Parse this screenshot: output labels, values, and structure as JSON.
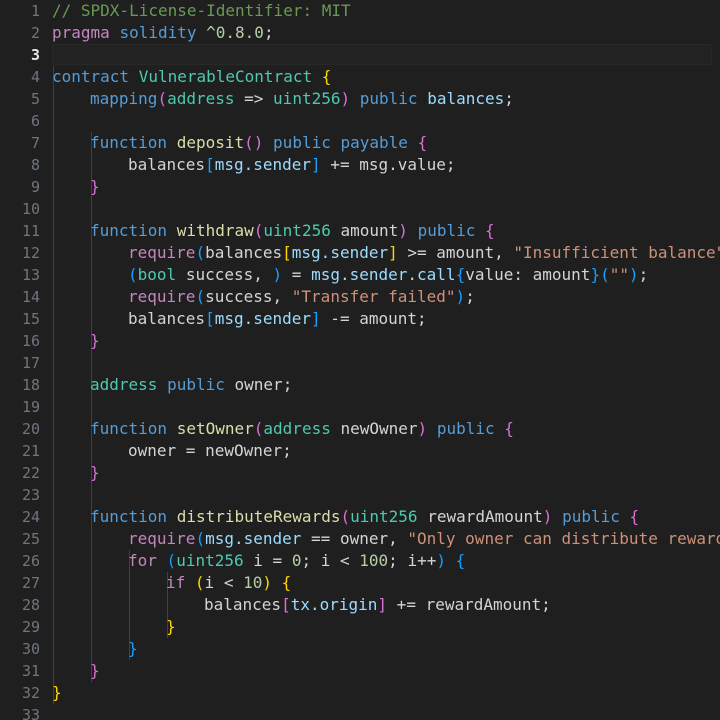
{
  "editor": {
    "language": "solidity",
    "theme": "dark-plus",
    "background": "#1f1f1f",
    "active_line": 3,
    "total_lines": 33,
    "line_numbers": [
      "1",
      "2",
      "3",
      "4",
      "5",
      "6",
      "7",
      "8",
      "9",
      "10",
      "11",
      "12",
      "13",
      "14",
      "15",
      "16",
      "17",
      "18",
      "19",
      "20",
      "21",
      "22",
      "23",
      "24",
      "25",
      "26",
      "27",
      "28",
      "29",
      "30",
      "31",
      "32",
      "33"
    ],
    "colors": {
      "comment": "#6a9955",
      "keyword": "#c586c0",
      "keyword_blue": "#569cd6",
      "type": "#4ec9b0",
      "function": "#dcdcaa",
      "string": "#ce9178",
      "number": "#b5cea8",
      "variable": "#9cdcfe",
      "plain": "#d4d4d4",
      "bracket_1": "#ffd700",
      "bracket_2": "#da70d6",
      "bracket_3": "#179fff",
      "line_number": "#6e7681",
      "line_number_active": "#e6e6e6",
      "indent_guide": "#404040"
    },
    "lines_plain": [
      "// SPDX-License-Identifier: MIT",
      "pragma solidity ^0.8.0;",
      "",
      "contract VulnerableContract {",
      "    mapping(address => uint256) public balances;",
      "",
      "    function deposit() public payable {",
      "        balances[msg.sender] += msg.value;",
      "    }",
      "",
      "    function withdraw(uint256 amount) public {",
      "        require(balances[msg.sender] >= amount, \"Insufficient balance\");",
      "        (bool success, ) = msg.sender.call{value: amount}(\"\");",
      "        require(success, \"Transfer failed\");",
      "        balances[msg.sender] -= amount;",
      "    }",
      "",
      "    address public owner;",
      "",
      "    function setOwner(address newOwner) public {",
      "        owner = newOwner;",
      "    }",
      "",
      "    function distributeRewards(uint256 rewardAmount) public {",
      "        require(msg.sender == owner, \"Only owner can distribute rewards\");",
      "        for (uint256 i = 0; i < 100; i++) {",
      "            if (i < 10) {",
      "                balances[tx.origin] += rewardAmount;",
      "            }",
      "        }",
      "    }",
      "}",
      ""
    ],
    "lines": [
      {
        "n": 1,
        "indent": 0,
        "tokens": [
          {
            "t": "// SPDX-License-Identifier: MIT",
            "c": "cmt"
          }
        ]
      },
      {
        "n": 2,
        "indent": 0,
        "tokens": [
          {
            "t": "pragma",
            "c": "kw"
          },
          {
            "t": " ",
            "c": "pln"
          },
          {
            "t": "solidity",
            "c": "kw2"
          },
          {
            "t": " ",
            "c": "pln"
          },
          {
            "t": "^0.8.0",
            "c": "num"
          },
          {
            "t": ";",
            "c": "pln"
          }
        ]
      },
      {
        "n": 3,
        "indent": 0,
        "tokens": []
      },
      {
        "n": 4,
        "indent": 0,
        "tokens": [
          {
            "t": "contract",
            "c": "kw2"
          },
          {
            "t": " ",
            "c": "pln"
          },
          {
            "t": "VulnerableContract",
            "c": "typ"
          },
          {
            "t": " ",
            "c": "pln"
          },
          {
            "t": "{",
            "c": "b1"
          }
        ]
      },
      {
        "n": 5,
        "indent": 1,
        "tokens": [
          {
            "t": "mapping",
            "c": "kw2"
          },
          {
            "t": "(",
            "c": "b2"
          },
          {
            "t": "address",
            "c": "typ"
          },
          {
            "t": " => ",
            "c": "pln"
          },
          {
            "t": "uint256",
            "c": "typ"
          },
          {
            "t": ")",
            "c": "b2"
          },
          {
            "t": " ",
            "c": "pln"
          },
          {
            "t": "public",
            "c": "kw2"
          },
          {
            "t": " ",
            "c": "pln"
          },
          {
            "t": "balances",
            "c": "var"
          },
          {
            "t": ";",
            "c": "pln"
          }
        ]
      },
      {
        "n": 6,
        "indent": 1,
        "tokens": []
      },
      {
        "n": 7,
        "indent": 1,
        "tokens": [
          {
            "t": "function",
            "c": "kw2"
          },
          {
            "t": " ",
            "c": "pln"
          },
          {
            "t": "deposit",
            "c": "fn"
          },
          {
            "t": "()",
            "c": "b2"
          },
          {
            "t": " ",
            "c": "pln"
          },
          {
            "t": "public",
            "c": "kw2"
          },
          {
            "t": " ",
            "c": "pln"
          },
          {
            "t": "payable",
            "c": "kw2"
          },
          {
            "t": " ",
            "c": "pln"
          },
          {
            "t": "{",
            "c": "b2"
          }
        ]
      },
      {
        "n": 8,
        "indent": 2,
        "tokens": [
          {
            "t": "balances",
            "c": "pln"
          },
          {
            "t": "[",
            "c": "b3"
          },
          {
            "t": "msg.sender",
            "c": "var"
          },
          {
            "t": "]",
            "c": "b3"
          },
          {
            "t": " += ",
            "c": "pln"
          },
          {
            "t": "msg.value",
            "c": "pln"
          },
          {
            "t": ";",
            "c": "pln"
          }
        ]
      },
      {
        "n": 9,
        "indent": 1,
        "tokens": [
          {
            "t": "}",
            "c": "b2"
          }
        ]
      },
      {
        "n": 10,
        "indent": 1,
        "tokens": []
      },
      {
        "n": 11,
        "indent": 1,
        "tokens": [
          {
            "t": "function",
            "c": "kw2"
          },
          {
            "t": " ",
            "c": "pln"
          },
          {
            "t": "withdraw",
            "c": "fn"
          },
          {
            "t": "(",
            "c": "b2"
          },
          {
            "t": "uint256",
            "c": "typ"
          },
          {
            "t": " ",
            "c": "pln"
          },
          {
            "t": "amount",
            "c": "pln"
          },
          {
            "t": ")",
            "c": "b2"
          },
          {
            "t": " ",
            "c": "pln"
          },
          {
            "t": "public",
            "c": "kw2"
          },
          {
            "t": " ",
            "c": "pln"
          },
          {
            "t": "{",
            "c": "b2"
          }
        ]
      },
      {
        "n": 12,
        "indent": 2,
        "tokens": [
          {
            "t": "require",
            "c": "kw"
          },
          {
            "t": "(",
            "c": "b3"
          },
          {
            "t": "balances",
            "c": "pln"
          },
          {
            "t": "[",
            "c": "b1"
          },
          {
            "t": "msg.sender",
            "c": "var"
          },
          {
            "t": "]",
            "c": "b1"
          },
          {
            "t": " >= ",
            "c": "pln"
          },
          {
            "t": "amount",
            "c": "pln"
          },
          {
            "t": ", ",
            "c": "pln"
          },
          {
            "t": "\"Insufficient balance\"",
            "c": "str"
          },
          {
            "t": ")",
            "c": "b3"
          },
          {
            "t": ";",
            "c": "pln"
          }
        ]
      },
      {
        "n": 13,
        "indent": 2,
        "tokens": [
          {
            "t": "(",
            "c": "b3"
          },
          {
            "t": "bool",
            "c": "typ"
          },
          {
            "t": " ",
            "c": "pln"
          },
          {
            "t": "success",
            "c": "pln"
          },
          {
            "t": ", ",
            "c": "pln"
          },
          {
            "t": ")",
            "c": "b3"
          },
          {
            "t": " = ",
            "c": "pln"
          },
          {
            "t": "msg.sender",
            "c": "var"
          },
          {
            "t": ".",
            "c": "pln"
          },
          {
            "t": "call",
            "c": "var"
          },
          {
            "t": "{",
            "c": "b3"
          },
          {
            "t": "value",
            "c": "pln"
          },
          {
            "t": ": ",
            "c": "pln"
          },
          {
            "t": "amount",
            "c": "pln"
          },
          {
            "t": "}",
            "c": "b3"
          },
          {
            "t": "(",
            "c": "b3"
          },
          {
            "t": "\"\"",
            "c": "str"
          },
          {
            "t": ")",
            "c": "b3"
          },
          {
            "t": ";",
            "c": "pln"
          }
        ]
      },
      {
        "n": 14,
        "indent": 2,
        "tokens": [
          {
            "t": "require",
            "c": "kw"
          },
          {
            "t": "(",
            "c": "b3"
          },
          {
            "t": "success",
            "c": "pln"
          },
          {
            "t": ", ",
            "c": "pln"
          },
          {
            "t": "\"Transfer failed\"",
            "c": "str"
          },
          {
            "t": ")",
            "c": "b3"
          },
          {
            "t": ";",
            "c": "pln"
          }
        ]
      },
      {
        "n": 15,
        "indent": 2,
        "tokens": [
          {
            "t": "balances",
            "c": "pln"
          },
          {
            "t": "[",
            "c": "b3"
          },
          {
            "t": "msg.sender",
            "c": "var"
          },
          {
            "t": "]",
            "c": "b3"
          },
          {
            "t": " -= ",
            "c": "pln"
          },
          {
            "t": "amount",
            "c": "pln"
          },
          {
            "t": ";",
            "c": "pln"
          }
        ]
      },
      {
        "n": 16,
        "indent": 1,
        "tokens": [
          {
            "t": "}",
            "c": "b2"
          }
        ]
      },
      {
        "n": 17,
        "indent": 1,
        "tokens": []
      },
      {
        "n": 18,
        "indent": 1,
        "tokens": [
          {
            "t": "address",
            "c": "typ"
          },
          {
            "t": " ",
            "c": "pln"
          },
          {
            "t": "public",
            "c": "kw2"
          },
          {
            "t": " ",
            "c": "pln"
          },
          {
            "t": "owner",
            "c": "pln"
          },
          {
            "t": ";",
            "c": "pln"
          }
        ]
      },
      {
        "n": 19,
        "indent": 1,
        "tokens": []
      },
      {
        "n": 20,
        "indent": 1,
        "tokens": [
          {
            "t": "function",
            "c": "kw2"
          },
          {
            "t": " ",
            "c": "pln"
          },
          {
            "t": "setOwner",
            "c": "fn"
          },
          {
            "t": "(",
            "c": "b2"
          },
          {
            "t": "address",
            "c": "typ"
          },
          {
            "t": " ",
            "c": "pln"
          },
          {
            "t": "newOwner",
            "c": "pln"
          },
          {
            "t": ")",
            "c": "b2"
          },
          {
            "t": " ",
            "c": "pln"
          },
          {
            "t": "public",
            "c": "kw2"
          },
          {
            "t": " ",
            "c": "pln"
          },
          {
            "t": "{",
            "c": "b2"
          }
        ]
      },
      {
        "n": 21,
        "indent": 2,
        "tokens": [
          {
            "t": "owner",
            "c": "pln"
          },
          {
            "t": " = ",
            "c": "pln"
          },
          {
            "t": "newOwner",
            "c": "pln"
          },
          {
            "t": ";",
            "c": "pln"
          }
        ]
      },
      {
        "n": 22,
        "indent": 1,
        "tokens": [
          {
            "t": "}",
            "c": "b2"
          }
        ]
      },
      {
        "n": 23,
        "indent": 1,
        "tokens": []
      },
      {
        "n": 24,
        "indent": 1,
        "tokens": [
          {
            "t": "function",
            "c": "kw2"
          },
          {
            "t": " ",
            "c": "pln"
          },
          {
            "t": "distributeRewards",
            "c": "fn"
          },
          {
            "t": "(",
            "c": "b2"
          },
          {
            "t": "uint256",
            "c": "typ"
          },
          {
            "t": " ",
            "c": "pln"
          },
          {
            "t": "rewardAmount",
            "c": "pln"
          },
          {
            "t": ")",
            "c": "b2"
          },
          {
            "t": " ",
            "c": "pln"
          },
          {
            "t": "public",
            "c": "kw2"
          },
          {
            "t": " ",
            "c": "pln"
          },
          {
            "t": "{",
            "c": "b2"
          }
        ]
      },
      {
        "n": 25,
        "indent": 2,
        "tokens": [
          {
            "t": "require",
            "c": "kw"
          },
          {
            "t": "(",
            "c": "b3"
          },
          {
            "t": "msg.sender",
            "c": "var"
          },
          {
            "t": " == ",
            "c": "pln"
          },
          {
            "t": "owner",
            "c": "pln"
          },
          {
            "t": ", ",
            "c": "pln"
          },
          {
            "t": "\"Only owner can distribute rewards\"",
            "c": "str"
          },
          {
            "t": ")",
            "c": "b3"
          },
          {
            "t": ";",
            "c": "pln"
          }
        ]
      },
      {
        "n": 26,
        "indent": 2,
        "tokens": [
          {
            "t": "for",
            "c": "kw"
          },
          {
            "t": " ",
            "c": "pln"
          },
          {
            "t": "(",
            "c": "b3"
          },
          {
            "t": "uint256",
            "c": "typ"
          },
          {
            "t": " ",
            "c": "pln"
          },
          {
            "t": "i",
            "c": "pln"
          },
          {
            "t": " = ",
            "c": "pln"
          },
          {
            "t": "0",
            "c": "num"
          },
          {
            "t": "; ",
            "c": "pln"
          },
          {
            "t": "i",
            "c": "pln"
          },
          {
            "t": " < ",
            "c": "pln"
          },
          {
            "t": "100",
            "c": "num"
          },
          {
            "t": "; ",
            "c": "pln"
          },
          {
            "t": "i++",
            "c": "pln"
          },
          {
            "t": ")",
            "c": "b3"
          },
          {
            "t": " ",
            "c": "pln"
          },
          {
            "t": "{",
            "c": "b3"
          }
        ]
      },
      {
        "n": 27,
        "indent": 3,
        "tokens": [
          {
            "t": "if",
            "c": "kw"
          },
          {
            "t": " ",
            "c": "pln"
          },
          {
            "t": "(",
            "c": "b1"
          },
          {
            "t": "i",
            "c": "pln"
          },
          {
            "t": " < ",
            "c": "pln"
          },
          {
            "t": "10",
            "c": "num"
          },
          {
            "t": ")",
            "c": "b1"
          },
          {
            "t": " ",
            "c": "pln"
          },
          {
            "t": "{",
            "c": "b1"
          }
        ]
      },
      {
        "n": 28,
        "indent": 4,
        "tokens": [
          {
            "t": "balances",
            "c": "pln"
          },
          {
            "t": "[",
            "c": "b2"
          },
          {
            "t": "tx.origin",
            "c": "var"
          },
          {
            "t": "]",
            "c": "b2"
          },
          {
            "t": " += ",
            "c": "pln"
          },
          {
            "t": "rewardAmount",
            "c": "pln"
          },
          {
            "t": ";",
            "c": "pln"
          }
        ]
      },
      {
        "n": 29,
        "indent": 3,
        "tokens": [
          {
            "t": "}",
            "c": "b1"
          }
        ]
      },
      {
        "n": 30,
        "indent": 2,
        "tokens": [
          {
            "t": "}",
            "c": "b3"
          }
        ]
      },
      {
        "n": 31,
        "indent": 1,
        "tokens": [
          {
            "t": "}",
            "c": "b2"
          }
        ]
      },
      {
        "n": 32,
        "indent": 0,
        "tokens": [
          {
            "t": "}",
            "c": "b1"
          }
        ]
      },
      {
        "n": 33,
        "indent": 0,
        "tokens": []
      }
    ],
    "indent_guides": [
      {
        "col": 0,
        "from": 4,
        "to": 32
      },
      {
        "col": 1,
        "from": 7,
        "to": 31
      },
      {
        "col": 2,
        "from": 26,
        "to": 30
      },
      {
        "col": 3,
        "from": 27,
        "to": 29
      }
    ]
  }
}
